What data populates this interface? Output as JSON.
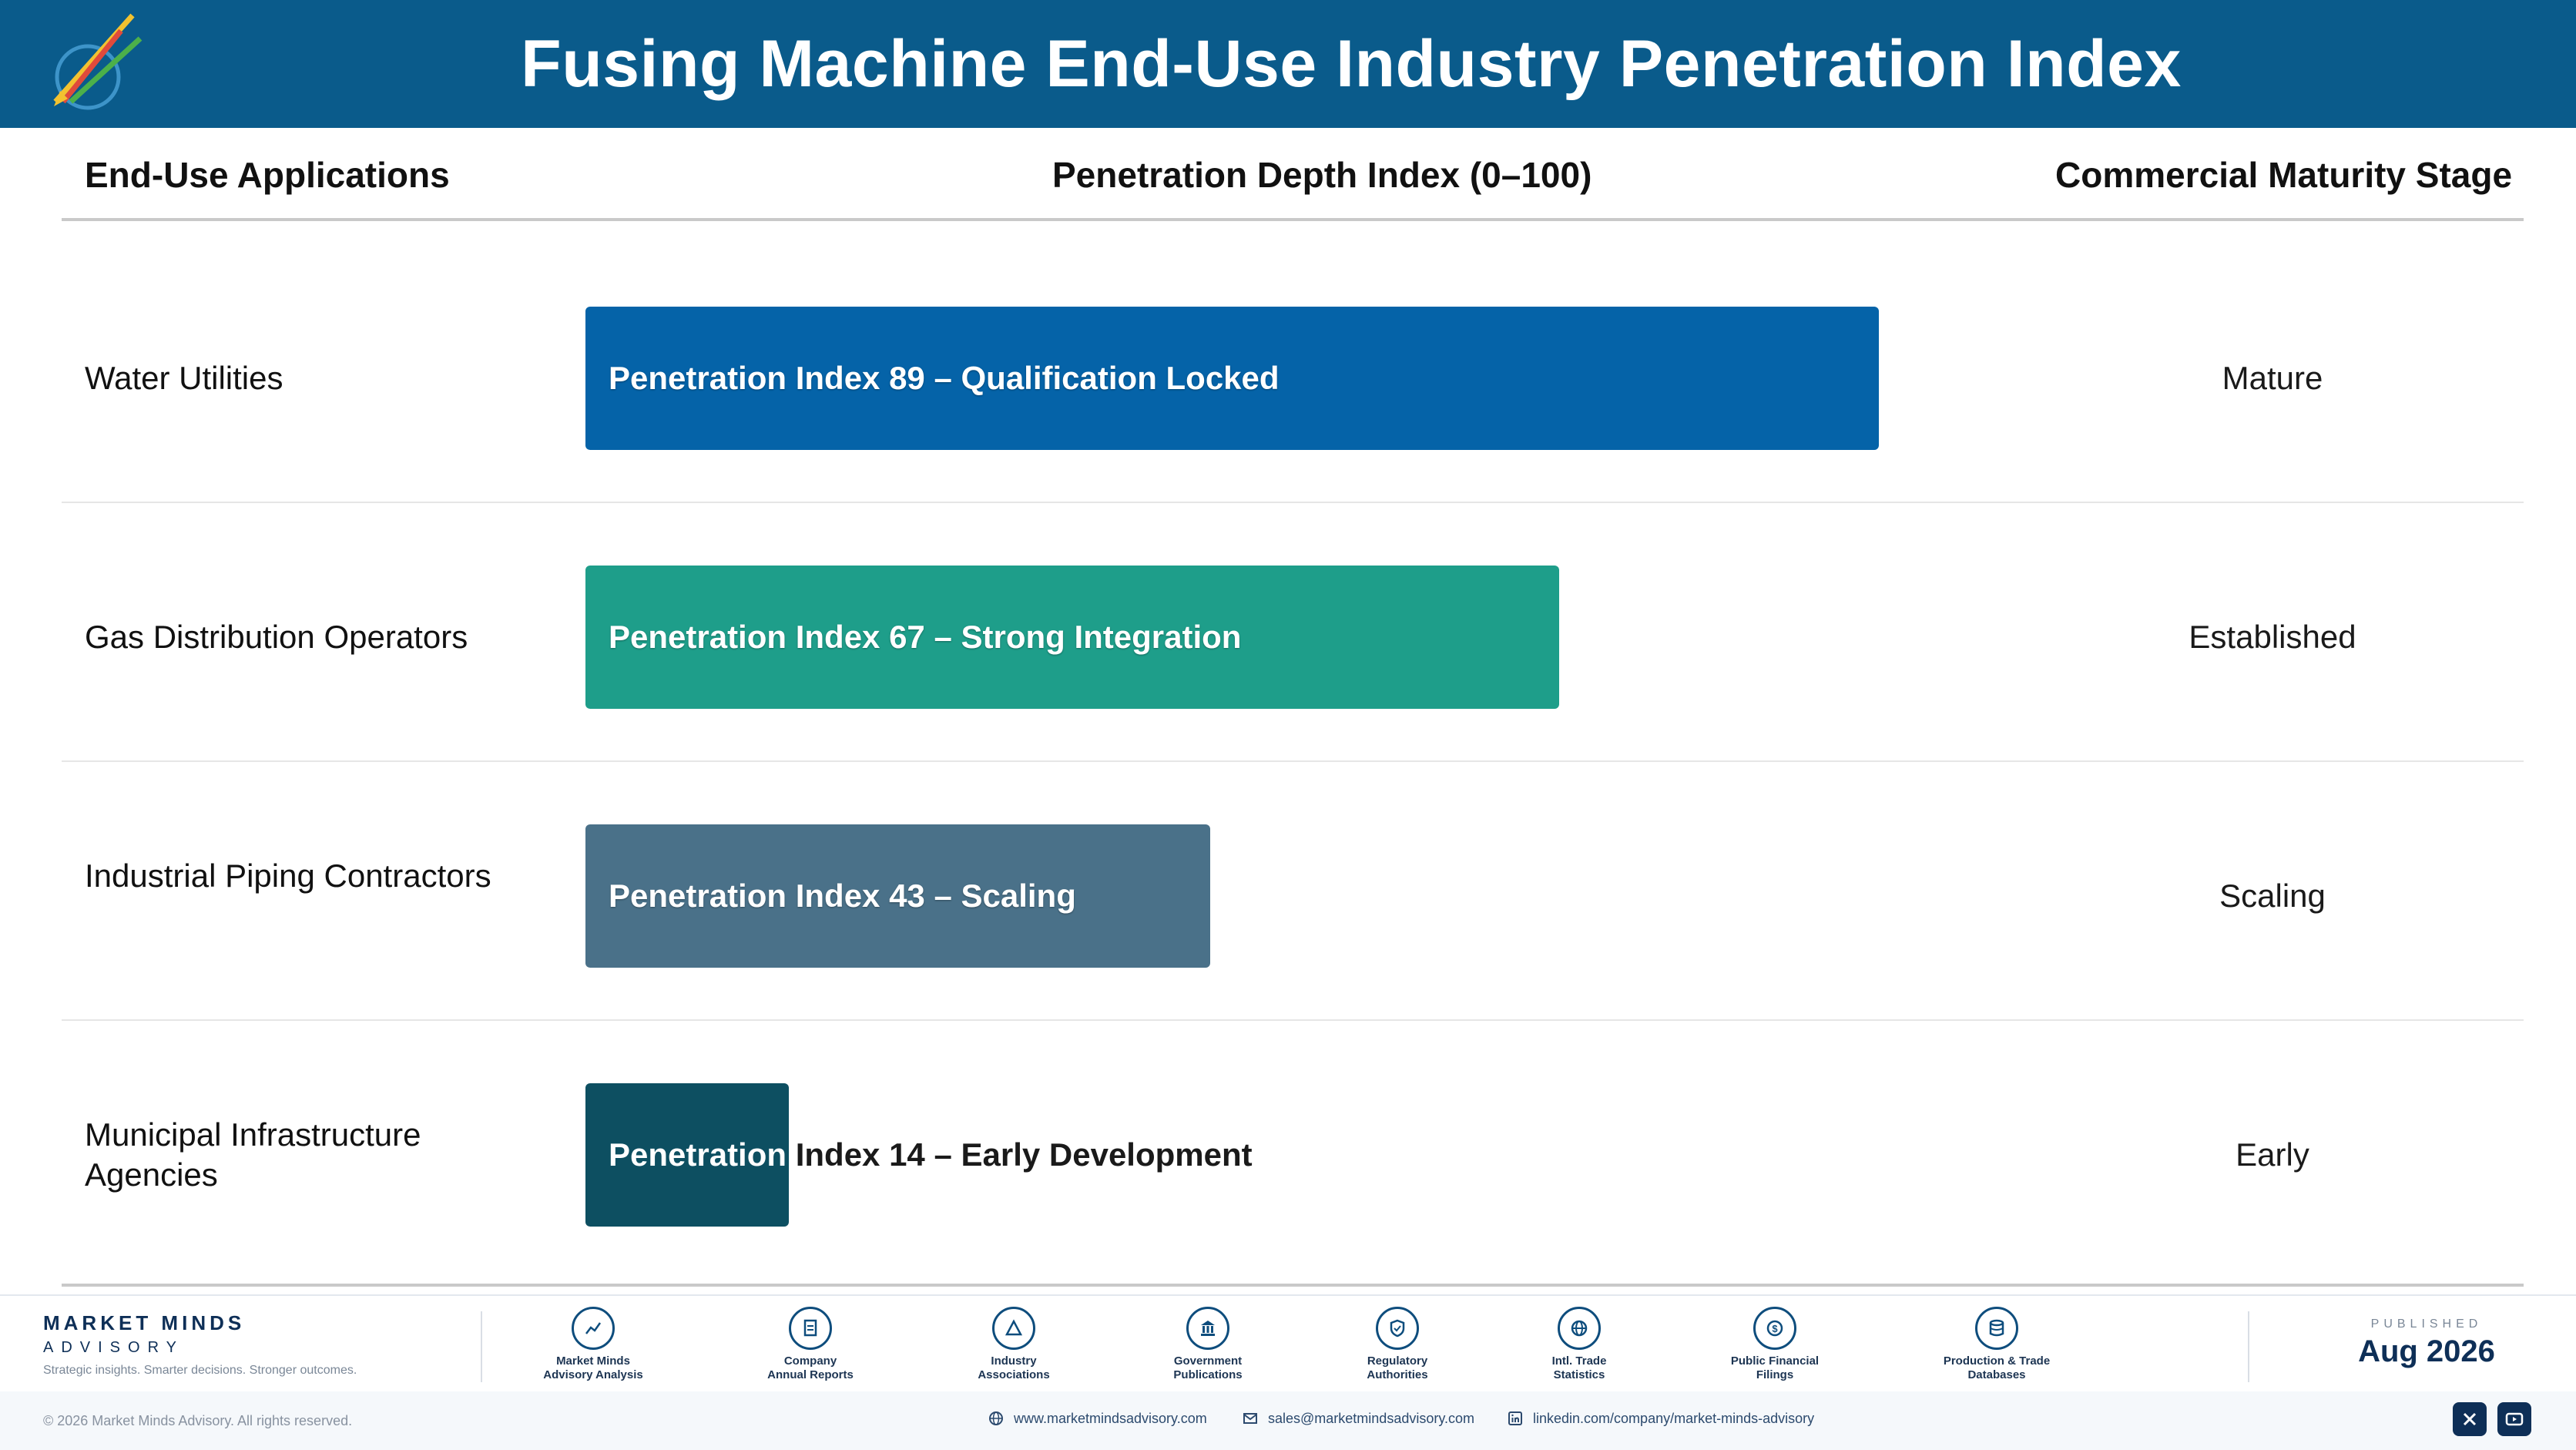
{
  "header": {
    "title": "Fusing Machine End-Use Industry Penetration Index"
  },
  "columns": {
    "applications": "End-Use Applications",
    "index": "Penetration Depth Index (0–100)",
    "stage": "Commercial Maturity Stage"
  },
  "chart_data": {
    "type": "bar",
    "orientation": "horizontal",
    "title": "Fusing Machine End-Use Industry Penetration Index",
    "xlabel": "Penetration Depth Index (0–100)",
    "xlim": [
      0,
      100
    ],
    "categories": [
      "Water Utilities",
      "Gas Distribution Operators",
      "Industrial Piping Contractors",
      "Municipal Infrastructure Agencies"
    ],
    "values": [
      89,
      67,
      43,
      14
    ],
    "bar_labels": [
      "Penetration Index 89 – Qualification Locked",
      "Penetration Index 67 – Strong Integration",
      "Penetration Index 43 – Scaling",
      "Penetration Index 14 – Early Development"
    ],
    "stages": [
      "Mature",
      "Established",
      "Scaling",
      "Early"
    ],
    "colors": [
      "#0563a8",
      "#1e9e8a",
      "#4a7189",
      "#0d4f61"
    ]
  },
  "footer": {
    "brand": "MARKET MINDS",
    "brand_sub": "ADVISORY",
    "tagline": "Strategic insights. Smarter decisions. Stronger outcomes.",
    "sources": [
      {
        "line1": "Market Minds",
        "line2": "Advisory Analysis",
        "icon": "trend-icon"
      },
      {
        "line1": "Company",
        "line2": "Annual Reports",
        "icon": "document-icon"
      },
      {
        "line1": "Industry",
        "line2": "Associations",
        "icon": "network-icon"
      },
      {
        "line1": "Government",
        "line2": "Publications",
        "icon": "building-icon"
      },
      {
        "line1": "Regulatory",
        "line2": "Authorities",
        "icon": "shield-icon"
      },
      {
        "line1": "Intl. Trade",
        "line2": "Statistics",
        "icon": "globe-icon"
      },
      {
        "line1": "Public Financial",
        "line2": "Filings",
        "icon": "dollar-icon"
      },
      {
        "line1": "Production & Trade",
        "line2": "Databases",
        "icon": "database-icon"
      }
    ],
    "published_label": "PUBLISHED",
    "published_date": "Aug 2026",
    "copyright": "© 2026 Market Minds Advisory. All rights reserved.",
    "website": "www.marketmindsadvisory.com",
    "email": "sales@marketmindsadvisory.com",
    "linkedin": "linkedin.com/company/market-minds-advisory"
  }
}
